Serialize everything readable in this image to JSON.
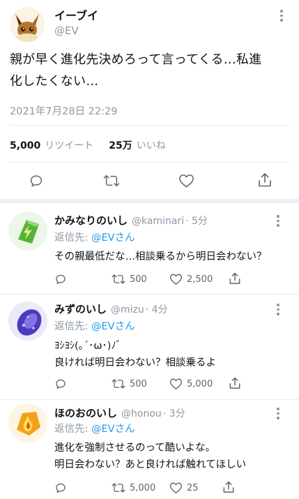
{
  "main_tweet": {
    "name": "イーブイ",
    "handle": "@EV",
    "text_line1": "親が早く進化先決めろって言ってくる…私進",
    "text_line2": "化したくない…",
    "timestamp": "2021年7月28日 22:29",
    "retweet_count": "5,000",
    "retweet_label": "リツイート",
    "like_count": "25万",
    "like_label": "いいね"
  },
  "replies": [
    {
      "name": "かみなりのいし",
      "handle": "@kaminari",
      "time": "· 5分",
      "reply_to_label": "返信先:",
      "reply_to_user": "@EVさん",
      "lines": [
        "その親最低だな…相談乗るから明日会わない？"
      ],
      "retweets": "500",
      "likes": "2,500",
      "avatar_color": "#6cc24a"
    },
    {
      "name": "みずのいし",
      "handle": "@mizu",
      "time": "· 4分",
      "reply_to_label": "返信先:",
      "reply_to_user": "@EVさん",
      "lines": [
        "ﾖｼﾖｼ(｡´･ω･)ﾉﾞ",
        "良ければ明日会わない？相談乗るよ"
      ],
      "retweets": "500",
      "likes": "5,000",
      "avatar_color": "#5a4ad1"
    },
    {
      "name": "ほのおのいし",
      "handle": "@honou",
      "time": "· 3分",
      "reply_to_label": "返信先:",
      "reply_to_user": "@EVさん",
      "lines": [
        "進化を強制させるのって酷いよな。",
        "明日会わない？あと良ければ触れてほしい"
      ],
      "retweets": "5,000",
      "likes": "25",
      "avatar_color": "#f0a020"
    }
  ],
  "icons": [
    "more-icon",
    "reply-icon",
    "retweet-icon",
    "like-icon",
    "share-icon"
  ]
}
